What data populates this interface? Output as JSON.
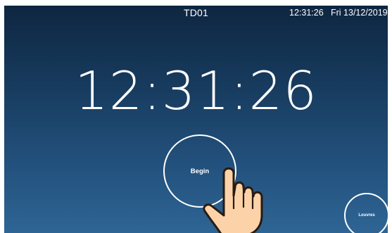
{
  "header": {
    "title": "TD01",
    "time": "12:31:26",
    "date": "Fri 13/12/2019"
  },
  "clock": {
    "display": "12:31:26"
  },
  "buttons": {
    "begin_label": "Begin",
    "louvres_label": "Louvres"
  },
  "icons": {
    "pointer": "hand-pointer-icon"
  },
  "colors": {
    "background_top": "#0e2641",
    "background_bottom": "#2e6594",
    "text": "#ffffff",
    "hand_fill": "#fcd3a8",
    "hand_outline": "#2a1a10"
  }
}
